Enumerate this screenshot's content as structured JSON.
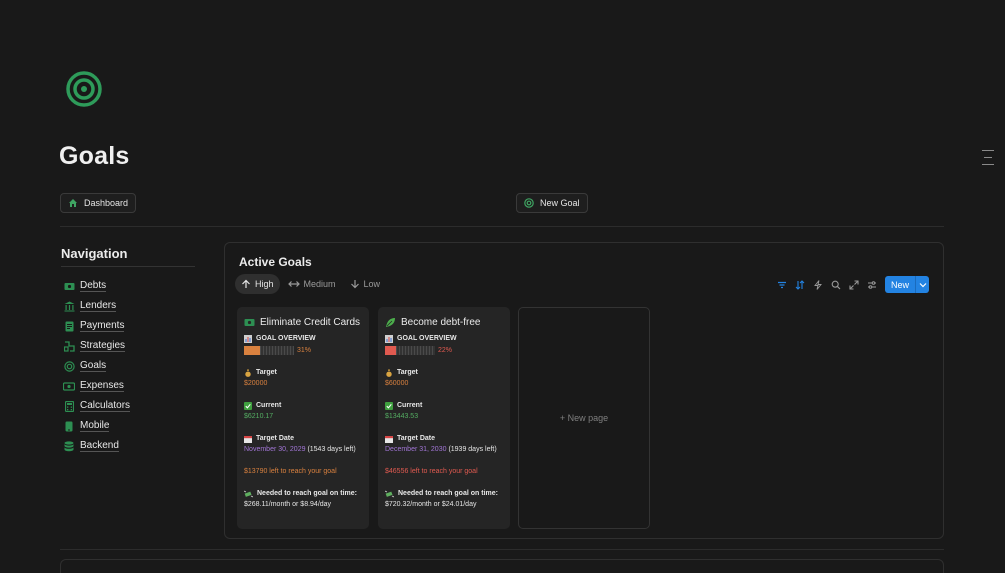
{
  "page": {
    "title": "Goals"
  },
  "buttons": {
    "dashboard": "Dashboard",
    "new_goal": "New Goal"
  },
  "navigation": {
    "title": "Navigation",
    "items": [
      {
        "label": "Debts",
        "icon": "banknote-icon"
      },
      {
        "label": "Lenders",
        "icon": "bank-icon"
      },
      {
        "label": "Payments",
        "icon": "receipt-icon"
      },
      {
        "label": "Strategies",
        "icon": "strategy-icon"
      },
      {
        "label": "Goals",
        "icon": "target-icon"
      },
      {
        "label": "Expenses",
        "icon": "money-icon"
      },
      {
        "label": "Calculators",
        "icon": "calculator-icon"
      },
      {
        "label": "Mobile",
        "icon": "mobile-icon"
      },
      {
        "label": "Backend",
        "icon": "database-icon"
      }
    ]
  },
  "database": {
    "title": "Active Goals",
    "views": [
      {
        "label": "High",
        "icon": "arrow-up-icon",
        "active": true
      },
      {
        "label": "Medium",
        "icon": "arrows-horizontal-icon",
        "active": false
      },
      {
        "label": "Low",
        "icon": "arrow-down-icon",
        "active": false
      }
    ],
    "new_label": "New",
    "new_page_label": "+ New page"
  },
  "cards": [
    {
      "title": "Eliminate Credit Cards",
      "overview_label": "GOAL OVERVIEW",
      "progress": 31,
      "progress_text": "31%",
      "progress_color": "#d9813f",
      "target_label": "Target",
      "target": "$20000",
      "current_label": "Current",
      "current": "$6210.17",
      "date_label": "Target Date",
      "date": "November 30, 2029",
      "days_left": "(1543 days left)",
      "left_text": "$13790 left to reach your goal",
      "needed_label": "Needed to reach goal on time:",
      "needed": "$268.11/month or $8.94/day"
    },
    {
      "title": "Become debt-free",
      "overview_label": "GOAL OVERVIEW",
      "progress": 22,
      "progress_text": "22%",
      "progress_color": "#e05a50",
      "target_label": "Target",
      "target": "$60000",
      "current_label": "Current",
      "current": "$13443.53",
      "date_label": "Target Date",
      "date": "December 31, 2030",
      "days_left": "(1939 days left)",
      "left_text": "$46556 left to reach your goal",
      "needed_label": "Needed to reach goal on time:",
      "needed": "$720.32/month or $24.01/day"
    }
  ],
  "colors": {
    "accent": "#2383e2",
    "green": "#54ad62",
    "orange": "#d9813f",
    "red": "#e05a50",
    "purple": "#a276d6"
  }
}
